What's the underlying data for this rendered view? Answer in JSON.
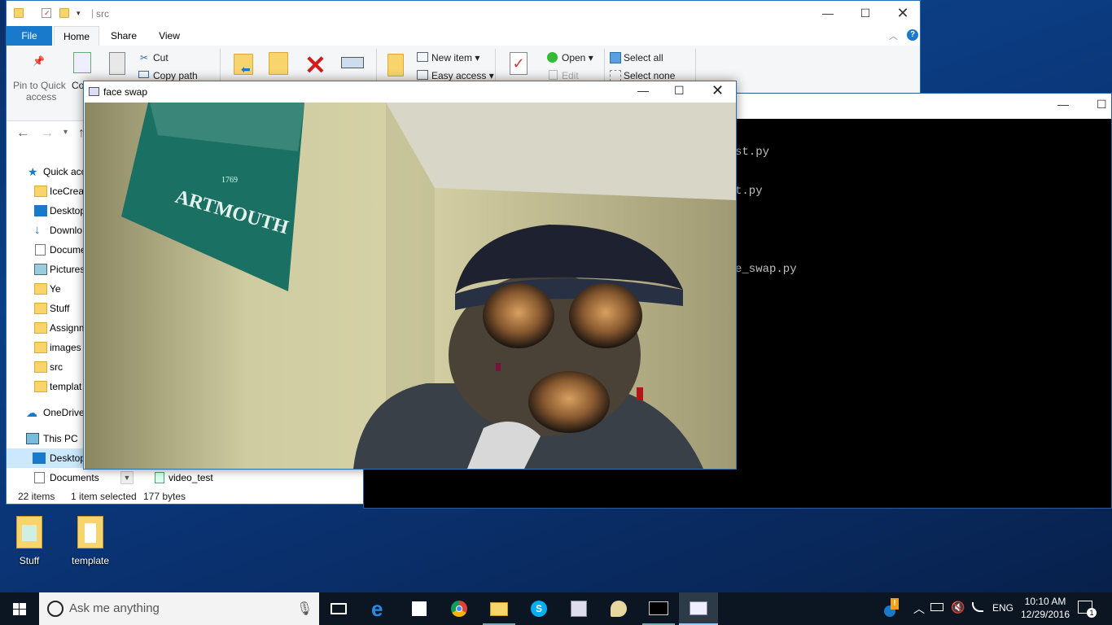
{
  "explorer": {
    "title": "src",
    "tabs": [
      "File",
      "Home",
      "Share",
      "View"
    ],
    "ribbon": {
      "pin_l1": "Pin to Quick",
      "pin_l2": "access",
      "copy": "Co",
      "cut": "Cut",
      "copy_path": "Copy path",
      "new_item": "New item",
      "easy_access": "Easy access",
      "open": "Open",
      "edit": "Edit",
      "select_all": "Select all",
      "select_none": "Select none"
    },
    "nav_items": [
      "Quick acc",
      "IceCrean",
      "Desktop",
      "Downlo",
      "Docume",
      "Pictures",
      "Ye",
      "Stuff",
      "Assignm",
      "images",
      "src",
      "templat",
      "OneDrive",
      "This PC",
      "Desktop",
      "Documents"
    ],
    "file_row": "video_test",
    "status": {
      "items": "22 items",
      "selected": "1 item selected",
      "size": "177 bytes"
    }
  },
  "console": {
    "lines": [
      "st.py",
      "t.py",
      "e_swap.py"
    ]
  },
  "faceswap": {
    "title": "face swap",
    "banner_line1": "ARTMOUTH",
    "banner_year": "1769"
  },
  "desktop_icons": [
    "Stuff",
    "template"
  ],
  "taskbar": {
    "search_placeholder": "Ask me anything",
    "lang": "ENG",
    "time": "10:10 AM",
    "date": "12/29/2016",
    "notif_count": "1"
  },
  "colors": {
    "accent": "#1979ca",
    "taskbar": "#0b1622",
    "console_bg": "#000000",
    "folder": "#f8d56c"
  }
}
